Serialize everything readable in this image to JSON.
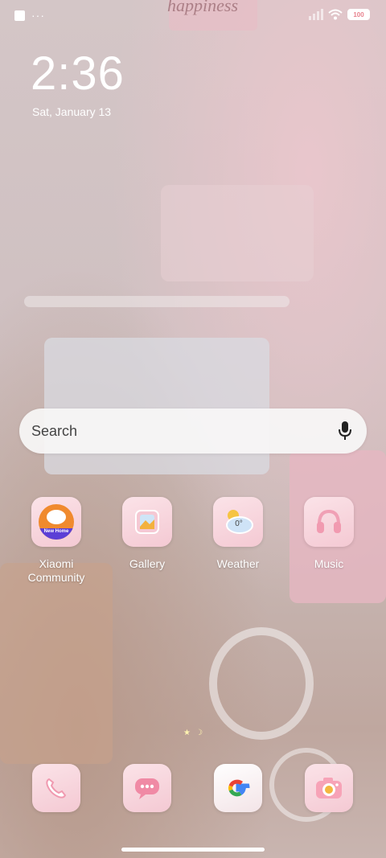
{
  "status_bar": {
    "battery": "100",
    "dots": "···"
  },
  "lock": {
    "time": "2:36",
    "date": "Sat, January 13"
  },
  "wallpaper": {
    "sign_text": "happiness"
  },
  "search": {
    "placeholder": "Search"
  },
  "apps": [
    {
      "label": "Xiaomi\nCommunity",
      "badge": "New Home",
      "icon": "xiaomi-community-icon"
    },
    {
      "label": "Gallery",
      "icon": "gallery-icon"
    },
    {
      "label": "Weather",
      "badge": "0°",
      "icon": "weather-icon"
    },
    {
      "label": "Music",
      "icon": "music-icon"
    }
  ],
  "dock": [
    {
      "name": "phone",
      "icon": "phone-icon"
    },
    {
      "name": "messages",
      "icon": "messages-icon"
    },
    {
      "name": "google",
      "icon": "google-icon"
    },
    {
      "name": "camera",
      "icon": "camera-icon"
    }
  ],
  "colors": {
    "icon_bg": "#f7d6de",
    "accent_pink": "#e8838f"
  }
}
